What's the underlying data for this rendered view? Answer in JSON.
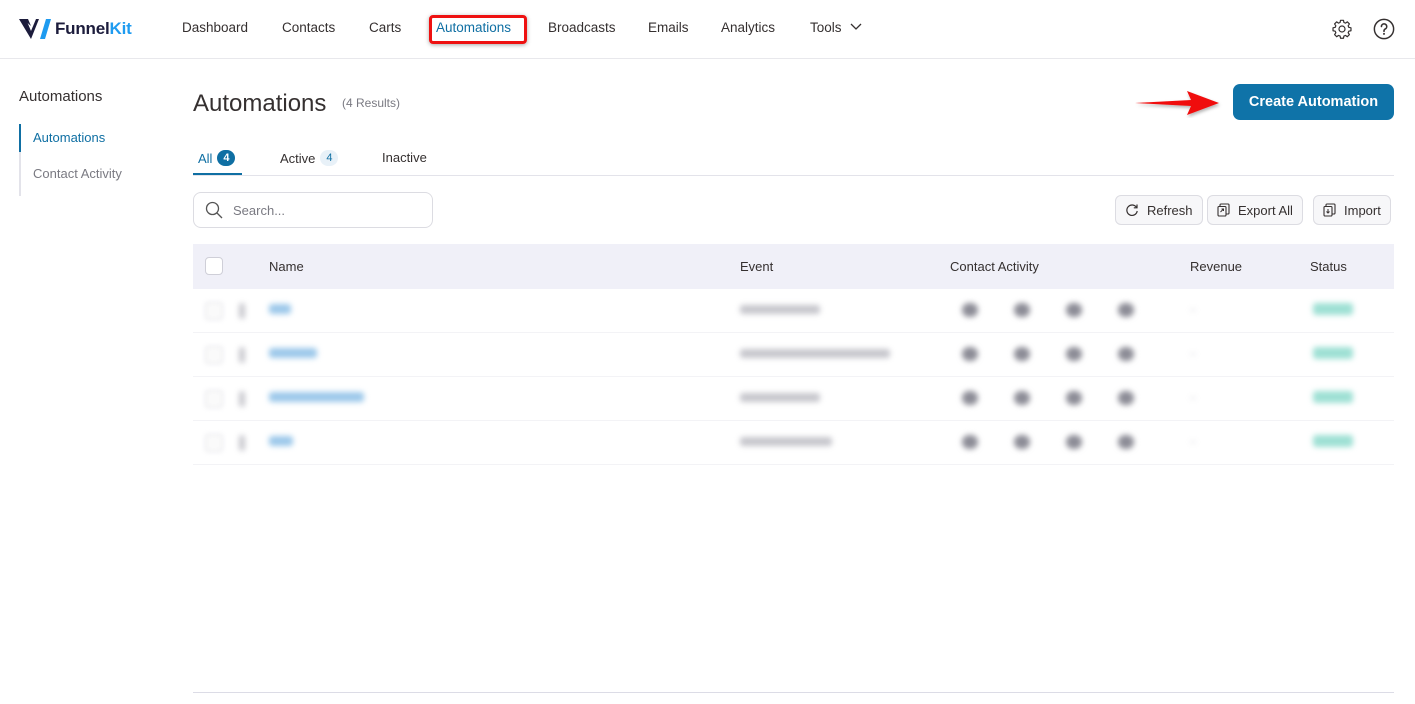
{
  "brand": {
    "name_part1": "Funnel",
    "name_part2": "Kit",
    "logo_icon": "funnelkit-logo-icon"
  },
  "nav": {
    "items": [
      {
        "label": "Dashboard",
        "active": false
      },
      {
        "label": "Contacts",
        "active": false
      },
      {
        "label": "Carts",
        "active": false
      },
      {
        "label": "Automations",
        "active": true
      },
      {
        "label": "Broadcasts",
        "active": false
      },
      {
        "label": "Emails",
        "active": false
      },
      {
        "label": "Analytics",
        "active": false
      },
      {
        "label": "Tools",
        "active": false,
        "has_dropdown": true
      }
    ],
    "right_icons": [
      "gear-icon",
      "help-circle-icon"
    ]
  },
  "sidebar": {
    "title": "Automations",
    "items": [
      {
        "label": "Automations",
        "active": true
      },
      {
        "label": "Contact Activity",
        "active": false
      }
    ]
  },
  "header": {
    "title": "Automations",
    "results": "(4 Results)",
    "create_button": "Create Automation"
  },
  "tabs": [
    {
      "label": "All",
      "count": "4",
      "active": true
    },
    {
      "label": "Active",
      "count": "4",
      "active": false
    },
    {
      "label": "Inactive",
      "count": null,
      "active": false
    }
  ],
  "search": {
    "placeholder": "Search...",
    "value": ""
  },
  "actions": {
    "refresh": "Refresh",
    "export_all": "Export All",
    "import": "Import"
  },
  "table": {
    "columns": [
      "Name",
      "Event",
      "Contact Activity",
      "Revenue",
      "Status"
    ],
    "rows_note": "Row contents are blurred/redacted in the screenshot",
    "row_count": 4
  },
  "colors": {
    "accent": "#0f73a8",
    "active_link": "#0f6fa3",
    "highlight_box": "#ee1111",
    "table_header_bg": "#f0f0f8"
  }
}
